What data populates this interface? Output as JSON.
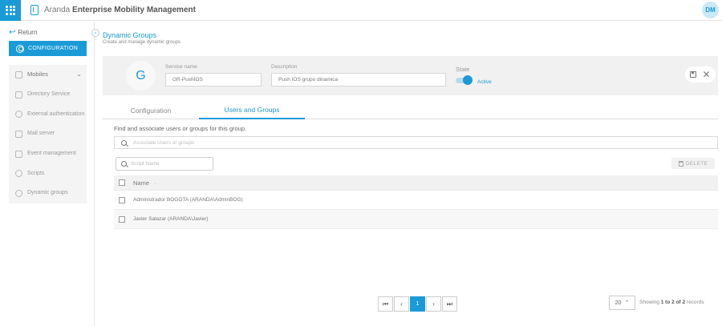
{
  "header": {
    "app_title_prefix": "Aranda",
    "app_title_main": "Enterprise Mobility Management",
    "avatar_initials": "DM"
  },
  "sidebar": {
    "return_label": "Return",
    "config_label": "CONFIGURATION",
    "items": [
      {
        "label": "Mobiles",
        "icon": "mobile-icon"
      },
      {
        "label": "Directory Service",
        "icon": "directory-icon"
      },
      {
        "label": "External authentication",
        "icon": "shield-icon"
      },
      {
        "label": "Mail server",
        "icon": "mail-icon"
      },
      {
        "label": "Event management",
        "icon": "calendar-icon"
      },
      {
        "label": "Scripts",
        "icon": "gear-icon"
      },
      {
        "label": "Dynamic groups",
        "icon": "groups-icon"
      }
    ]
  },
  "page": {
    "title": "Dynamic Groups",
    "subtitle": "Create and manage dynamic groups"
  },
  "group": {
    "badge_letter": "G",
    "service_name_label": "Service name",
    "service_name_value": "GR-PushIOS",
    "description_label": "Description",
    "description_value": "Push IOS grupo dinamica",
    "state_label": "State",
    "state_value": "Active"
  },
  "tabs": [
    {
      "label": "Configuration",
      "active": false
    },
    {
      "label": "Users and Groups",
      "active": true
    }
  ],
  "users_groups": {
    "find_text": "Find and associate users or groups for this group.",
    "associate_placeholder": "Associate Users or groups",
    "script_name_placeholder": "Script Name",
    "delete_label": "DELETE",
    "column_name": "Name",
    "rows": [
      "Administrador BOGOTA (ARANDA\\AdminBOG)",
      "Javier Salazar (ARANDA\\Javier)"
    ]
  },
  "pagination": {
    "current_page": "1",
    "page_size": "20",
    "records_prefix": "Showing",
    "records_range": "1 to 2 of 2",
    "records_suffix": "records"
  },
  "colors": {
    "accent": "#1a9bd7"
  }
}
